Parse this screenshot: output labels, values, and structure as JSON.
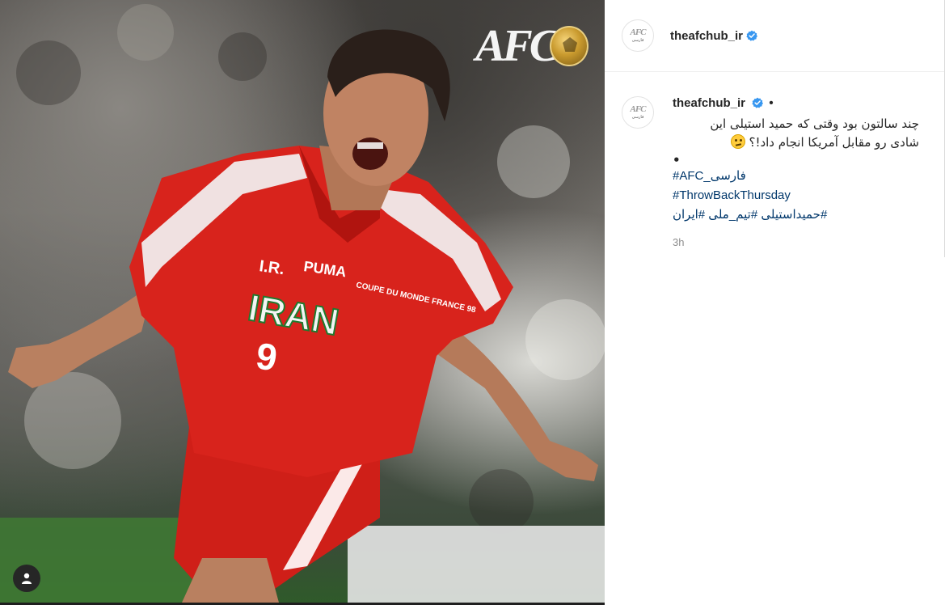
{
  "post": {
    "username": "theafchub_ir",
    "avatar_logo_text": "AFC",
    "avatar_sub_text": "فارسی",
    "logo_text": "AFC",
    "shirt_text": [
      "I.R.",
      "PUMA",
      "IRAN",
      "COUPE DU MONDE FRANCE 98",
      "9"
    ],
    "caption": {
      "line1": "چند سالتون بود وقتی که حمید استیلی این",
      "line2": "شادی رو مقابل آمریکا انجام داد!؟",
      "bullet": "•",
      "emoji": "thinking-face-emoji"
    },
    "hashtags": [
      "#AFC_فارسی",
      "#ThrowBackThursday",
      "#حمیداستیلی #تیم_ملی #ایران"
    ],
    "time": "3h",
    "separator": "•"
  },
  "icons": {
    "verified": "verified-badge-icon",
    "profile": "user-profile-icon"
  },
  "colors": {
    "link": "#00376b",
    "verified": "#3897f0",
    "muted": "#8e8e8e",
    "jersey_red": "#d8231c"
  }
}
